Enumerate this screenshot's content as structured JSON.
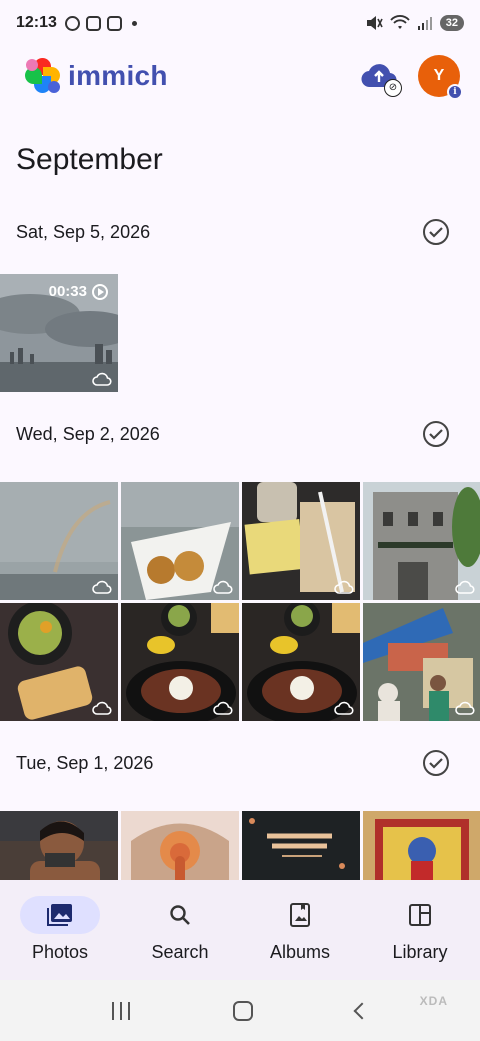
{
  "status_bar": {
    "time": "12:13",
    "battery": "32",
    "icons": [
      "whatsapp-icon",
      "calendar-icon",
      "instagram-icon",
      "mute-icon",
      "wifi-icon",
      "signal-icon"
    ]
  },
  "app_bar": {
    "app_name": "immich",
    "avatar_initial": "Y",
    "avatar_color": "#e8600a",
    "brand_color": "#4250af"
  },
  "timeline": {
    "month": "September",
    "groups": [
      {
        "date": "Sat, Sep 5, 2026",
        "items": [
          {
            "type": "video",
            "duration": "00:33",
            "scene": "sky-city"
          }
        ]
      },
      {
        "date": "Wed, Sep 2, 2026",
        "items": [
          {
            "type": "photo",
            "scene": "rainbow-sea"
          },
          {
            "type": "photo",
            "scene": "snack-cone"
          },
          {
            "type": "photo",
            "scene": "starbucks-note"
          },
          {
            "type": "photo",
            "scene": "heritage-building"
          },
          {
            "type": "photo",
            "scene": "salad-bread"
          },
          {
            "type": "photo",
            "scene": "sizzler-plate"
          },
          {
            "type": "photo",
            "scene": "sizzler-plate-2"
          },
          {
            "type": "photo",
            "scene": "street-market"
          }
        ]
      },
      {
        "date": "Tue, Sep 1, 2026",
        "items": [
          {
            "type": "photo",
            "scene": "selfie"
          },
          {
            "type": "photo",
            "scene": "ganesha-art"
          },
          {
            "type": "photo",
            "scene": "neon-sign"
          },
          {
            "type": "photo",
            "scene": "framed-painting"
          }
        ]
      }
    ]
  },
  "bottom_nav": {
    "items": [
      {
        "label": "Photos",
        "icon": "photos-icon",
        "active": true
      },
      {
        "label": "Search",
        "icon": "search-icon",
        "active": false
      },
      {
        "label": "Albums",
        "icon": "albums-icon",
        "active": false
      },
      {
        "label": "Library",
        "icon": "library-icon",
        "active": false
      }
    ]
  },
  "system_nav": {
    "watermark": "XDA"
  }
}
